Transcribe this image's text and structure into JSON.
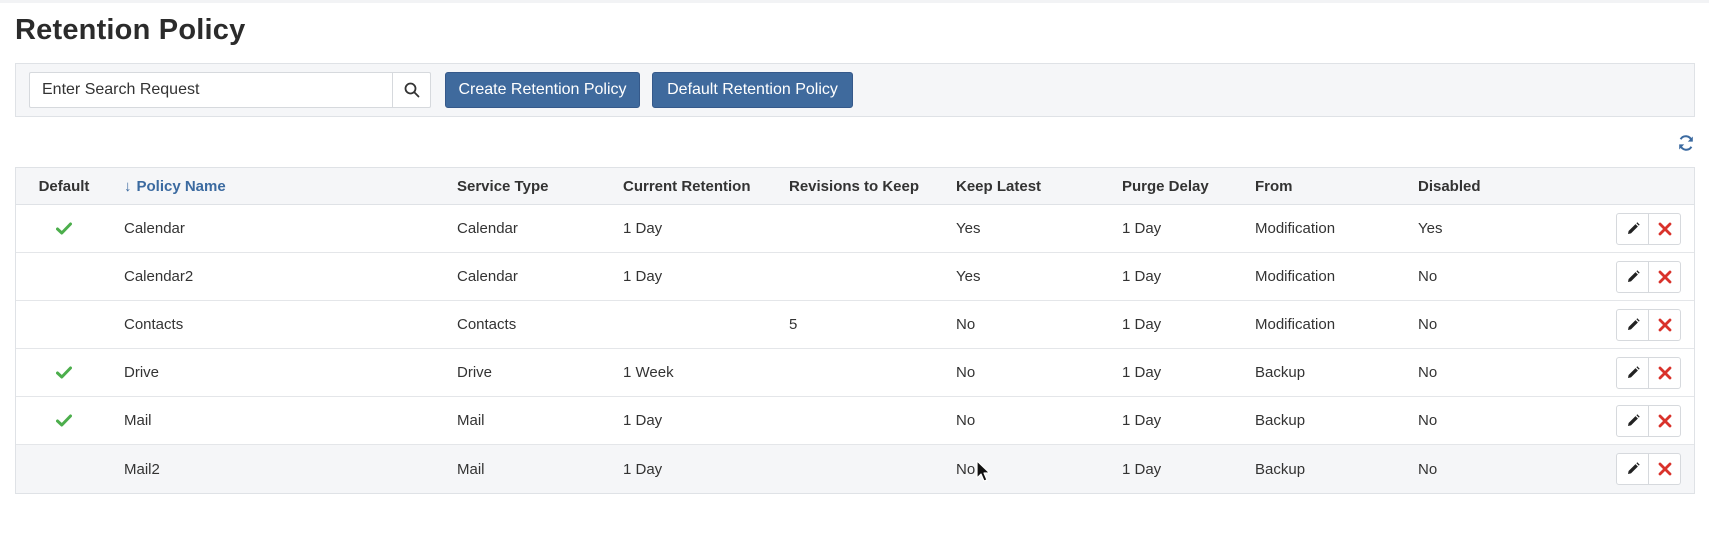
{
  "page": {
    "title": "Retention Policy"
  },
  "toolbar": {
    "search_placeholder": "Enter Search Request",
    "search_icon": "search-icon",
    "create_label": "Create Retention Policy",
    "default_label": "Default Retention Policy"
  },
  "refresh_icon": "refresh-icon",
  "table": {
    "columns": {
      "default": "Default",
      "name": "Policy Name",
      "service": "Service Type",
      "current": "Current Retention",
      "revisions": "Revisions to Keep",
      "latest": "Keep Latest",
      "purge": "Purge Delay",
      "from": "From",
      "disabled": "Disabled"
    },
    "sort_indicator": "↓",
    "rows": [
      {
        "default": true,
        "name": "Calendar",
        "service": "Calendar",
        "current": "1 Day",
        "revisions": "",
        "latest": "Yes",
        "purge": "1 Day",
        "from": "Modification",
        "disabled": "Yes"
      },
      {
        "default": false,
        "name": "Calendar2",
        "service": "Calendar",
        "current": "1 Day",
        "revisions": "",
        "latest": "Yes",
        "purge": "1 Day",
        "from": "Modification",
        "disabled": "No"
      },
      {
        "default": false,
        "name": "Contacts",
        "service": "Contacts",
        "current": "",
        "revisions": "5",
        "latest": "No",
        "purge": "1 Day",
        "from": "Modification",
        "disabled": "No"
      },
      {
        "default": true,
        "name": "Drive",
        "service": "Drive",
        "current": "1 Week",
        "revisions": "",
        "latest": "No",
        "purge": "1 Day",
        "from": "Backup",
        "disabled": "No"
      },
      {
        "default": true,
        "name": "Mail",
        "service": "Mail",
        "current": "1 Day",
        "revisions": "",
        "latest": "No",
        "purge": "1 Day",
        "from": "Backup",
        "disabled": "No"
      },
      {
        "default": false,
        "name": "Mail2",
        "service": "Mail",
        "current": "1 Day",
        "revisions": "",
        "latest": "No",
        "purge": "1 Day",
        "from": "Backup",
        "disabled": "No"
      }
    ],
    "row_actions": {
      "edit_icon": "pencil-icon",
      "delete_icon": "close-icon"
    }
  },
  "colors": {
    "accent": "#3f6a9d",
    "check": "#4cae4c",
    "delete": "#d9322b"
  }
}
